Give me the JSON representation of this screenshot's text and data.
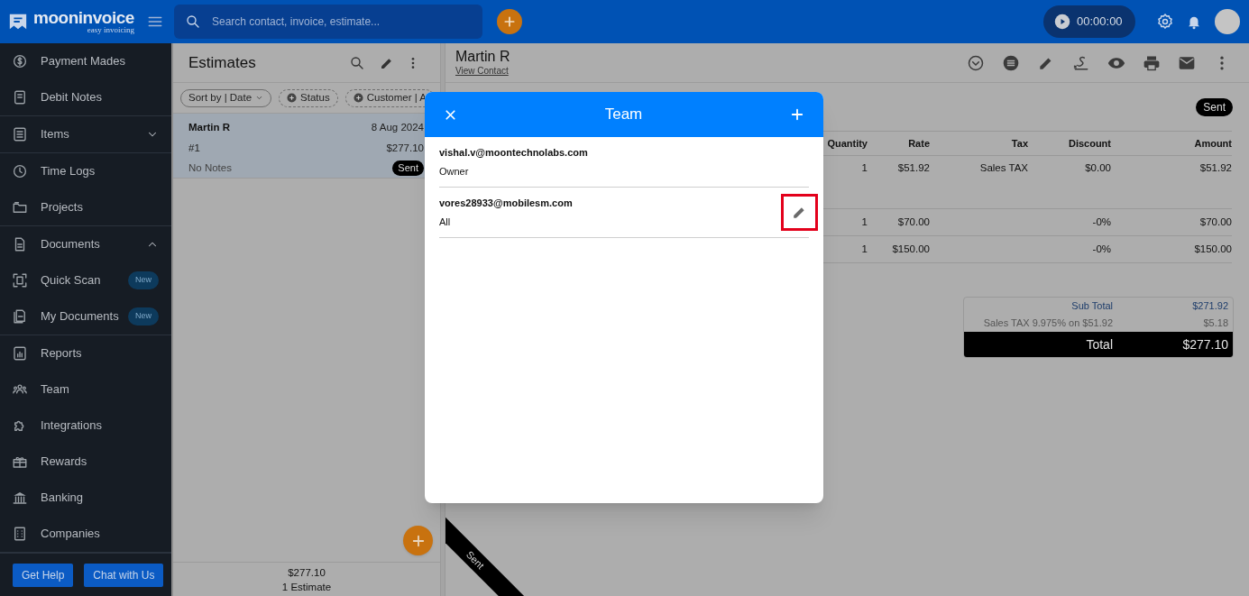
{
  "header": {
    "logo": {
      "name": "mooninvoice",
      "tagline": "easy invoicing"
    },
    "search": {
      "placeholder": "Search contact, invoice, estimate..."
    },
    "timer": "00:00:00"
  },
  "sidebar": {
    "sections": [
      {
        "items": [
          {
            "label": "Payment Mades"
          },
          {
            "label": "Debit Notes"
          }
        ]
      },
      {
        "items": [
          {
            "label": "Items",
            "expanded": false
          }
        ]
      },
      {
        "items": [
          {
            "label": "Time Logs"
          },
          {
            "label": "Projects"
          }
        ]
      },
      {
        "items": [
          {
            "label": "Documents",
            "expanded": true
          },
          {
            "label": "Quick Scan",
            "badge": "New"
          },
          {
            "label": "My Documents",
            "badge": "New"
          }
        ]
      },
      {
        "items": [
          {
            "label": "Reports"
          },
          {
            "label": "Team"
          },
          {
            "label": "Integrations"
          },
          {
            "label": "Rewards"
          },
          {
            "label": "Banking"
          },
          {
            "label": "Companies"
          }
        ]
      }
    ],
    "buttons": [
      "Get Help",
      "Chat with Us"
    ]
  },
  "estimates_panel": {
    "title": "Estimates",
    "filters": [
      {
        "label": "Sort by | Date",
        "kind": "sort"
      },
      {
        "label": "Status",
        "kind": "add"
      },
      {
        "label": "Customer | A",
        "kind": "add"
      }
    ],
    "rows": [
      {
        "customer": "Martin R",
        "date": "8 Aug 2024",
        "number": "#1",
        "amount": "$277.10",
        "notes": "No Notes",
        "status": "Sent",
        "selected": true
      }
    ],
    "footer": {
      "total": "$277.10",
      "count": "1 Estimate"
    }
  },
  "detail": {
    "customer": "Martin R",
    "link": "View Contact",
    "status": "Sent",
    "table": {
      "columns": [
        "Quantity",
        "Rate",
        "Tax",
        "Discount",
        "Amount"
      ],
      "rows": [
        {
          "quantity": "1",
          "rate": "$51.92",
          "tax": "Sales TAX",
          "discount": "$0.00",
          "amount": "$51.92"
        },
        {
          "quantity": "1",
          "rate": "$70.00",
          "discount": "-0%",
          "amount": "$70.00"
        },
        {
          "quantity": "1",
          "rate": "$150.00",
          "discount": "-0%",
          "amount": "$150.00"
        }
      ]
    },
    "totals": [
      {
        "label": "Sub Total",
        "value": "$271.92",
        "kind": "subtotal"
      },
      {
        "label": "Sales TAX 9.975% on $51.92",
        "value": "$5.18",
        "kind": "tax"
      },
      {
        "label": "Total",
        "value": "$277.10",
        "kind": "total"
      }
    ],
    "ribbon": "Sent"
  },
  "team_dialog": {
    "title": "Team",
    "members": [
      {
        "email": "vishal.v@moontechnolabs.com",
        "role": "Owner",
        "editable": false,
        "highlighted": false
      },
      {
        "email": "vores28933@mobilesm.com",
        "role": "All",
        "editable": true,
        "highlighted": true
      }
    ]
  }
}
